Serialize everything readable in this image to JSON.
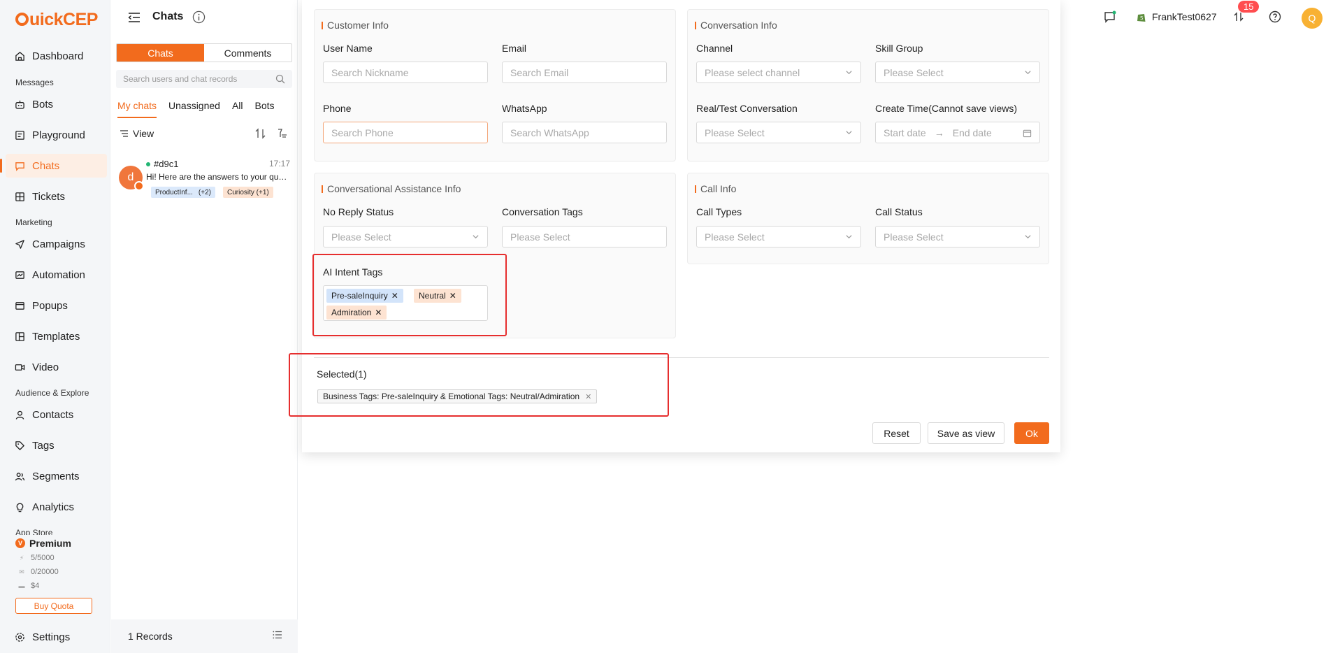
{
  "app": {
    "logo_text": "uickCEP",
    "accent": "#f26b1d"
  },
  "sidebar": {
    "items": [
      {
        "label": "Dashboard"
      },
      {
        "label": "Bots"
      },
      {
        "label": "Playground"
      },
      {
        "label": "Chats"
      },
      {
        "label": "Tickets"
      },
      {
        "label": "Campaigns"
      },
      {
        "label": "Automation"
      },
      {
        "label": "Popups"
      },
      {
        "label": "Templates"
      },
      {
        "label": "Video"
      },
      {
        "label": "Contacts"
      },
      {
        "label": "Tags"
      },
      {
        "label": "Segments"
      },
      {
        "label": "Analytics"
      },
      {
        "label": "Settings"
      }
    ],
    "sections": {
      "messages": "Messages",
      "marketing": "Marketing",
      "audience": "Audience & Explore",
      "appstore": "App Store"
    },
    "premium": {
      "label": "Premium",
      "q1": "5/5000",
      "q2": "0/20000",
      "q3": "$4",
      "buy": "Buy Quota"
    }
  },
  "chats": {
    "title": "Chats",
    "tabs": {
      "chats": "Chats",
      "comments": "Comments"
    },
    "search_placeholder": "Search users and chat records",
    "filters": [
      "My chats",
      "Unassigned",
      "All",
      "Bots"
    ],
    "view_label": "View",
    "item": {
      "avatar": "d",
      "name": "#d9c1",
      "time": "17:17",
      "message": "Hi! Here are the answers to your questions about",
      "tag1": "ProductInf...",
      "tag1_count": "(+2)",
      "tag2": "Curiosity (+1)"
    },
    "records": "1 Records"
  },
  "header": {
    "username": "FrankTest0627",
    "badge": "15",
    "avatar": "Q"
  },
  "panel": {
    "customer": {
      "title": "Customer Info",
      "username_label": "User Name",
      "username_ph": "Search Nickname",
      "email_label": "Email",
      "email_ph": "Search Email",
      "phone_label": "Phone",
      "phone_ph": "Search Phone",
      "whatsapp_label": "WhatsApp",
      "whatsapp_ph": "Search WhatsApp"
    },
    "conversation": {
      "title": "Conversation Info",
      "channel_label": "Channel",
      "channel_ph": "Please select channel",
      "skill_label": "Skill Group",
      "skill_ph": "Please Select",
      "realtest_label": "Real/Test Conversation",
      "realtest_ph": "Please Select",
      "create_label": "Create Time(Cannot save views)",
      "start_ph": "Start date",
      "end_ph": "End date"
    },
    "assist": {
      "title": "Conversational Assistance Info",
      "noreply_label": "No Reply Status",
      "noreply_ph": "Please Select",
      "convtags_label": "Conversation Tags",
      "convtags_ph": "Please Select",
      "ai_label": "AI Intent Tags",
      "ai_tags": [
        "Pre-saleInquiry",
        "Neutral",
        "Admiration"
      ]
    },
    "call": {
      "title": "Call Info",
      "types_label": "Call Types",
      "types_ph": "Please Select",
      "status_label": "Call Status",
      "status_ph": "Please Select"
    },
    "selected": {
      "label": "Selected(1)",
      "chip": "Business Tags: Pre-saleInquiry & Emotional Tags: Neutral/Admiration"
    },
    "buttons": {
      "reset": "Reset",
      "save": "Save as view",
      "ok": "Ok"
    }
  }
}
